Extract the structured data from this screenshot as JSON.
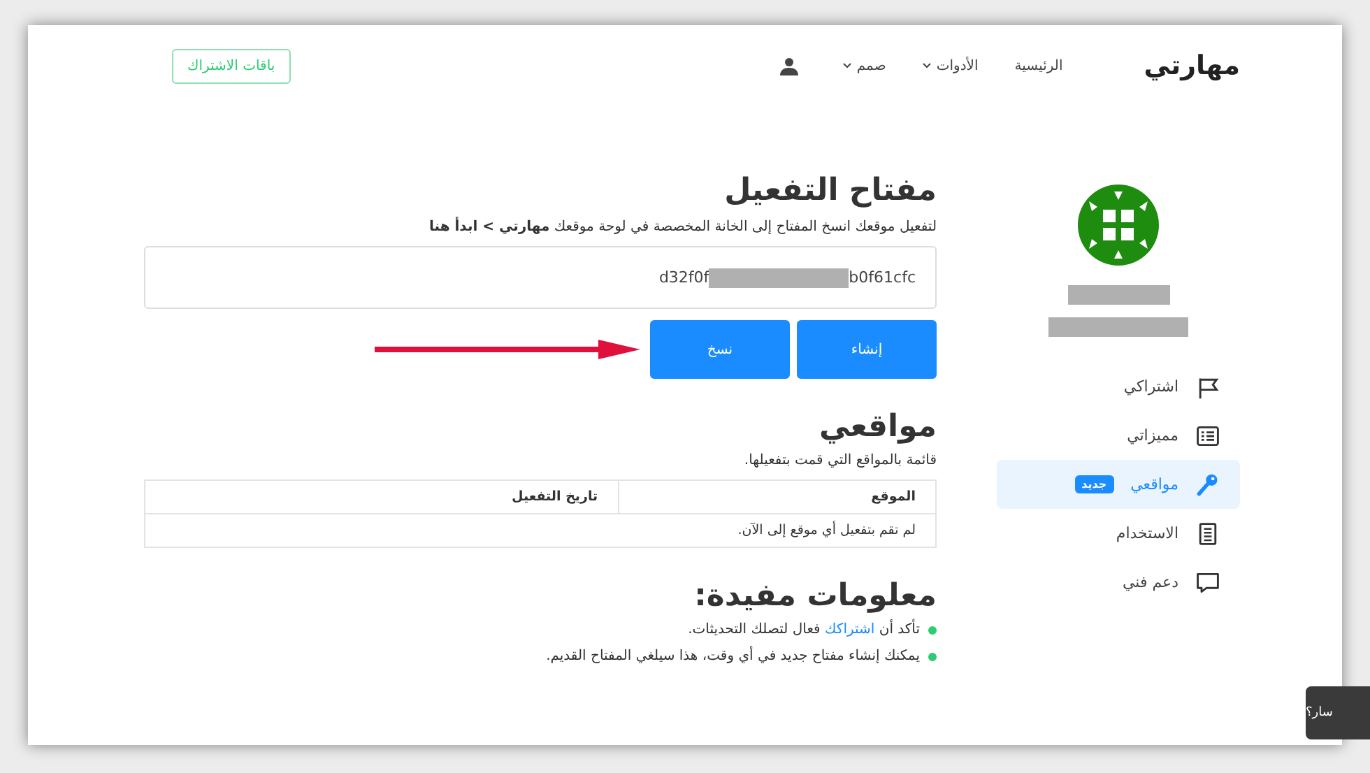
{
  "header": {
    "logo": "مهارتي",
    "nav": [
      {
        "label": "الرئيسية",
        "dropdown": false
      },
      {
        "label": "الأدوات",
        "dropdown": true
      },
      {
        "label": "صمم",
        "dropdown": true
      }
    ],
    "subscribe_button": "باقات الاشتراك"
  },
  "sidebar": {
    "items": [
      {
        "label": "اشتراكي",
        "kind": "flag",
        "selected": false
      },
      {
        "label": "مميزاتي",
        "kind": "list",
        "selected": false
      },
      {
        "label": "مواقعي",
        "kind": "key",
        "selected": true,
        "badge": "جديد"
      },
      {
        "label": "الاستخدام",
        "kind": "document",
        "selected": false
      },
      {
        "label": "دعم فني",
        "kind": "chat",
        "selected": false
      }
    ]
  },
  "activation": {
    "title": "مفتاح التفعيل",
    "instructions": "لتفعيل موقعك انسخ المفتاح إلى الخانة المخصصة في لوحة موقعك **مهارتي > ابدأ هنا**",
    "key_start": "d32f0f",
    "key_end": "b0f61cfc",
    "buttons": [
      {
        "label": "إنشاء"
      },
      {
        "label": "نسخ"
      }
    ]
  },
  "sites": {
    "title": "مواقعي",
    "description": "قائمة بالمواقع التي قمت بتفعيلها.",
    "columns": [
      "الموقع",
      "تاريخ التفعيل"
    ],
    "empty_message": "لم تقم بتفعيل أي موقع إلى الآن."
  },
  "tips": {
    "title": "معلومات مفيدة:",
    "items": [
      {
        "before": "تأكد أن",
        "link": "اشتراكك",
        "after": "فعال لتصلك التحديثات."
      },
      {
        "before": "يمكنك إنشاء مفتاح جديد في أي وقت، هذا سيلغي المفتاح القديم."
      }
    ]
  },
  "chat_tab": {
    "label": "سار؟"
  }
}
